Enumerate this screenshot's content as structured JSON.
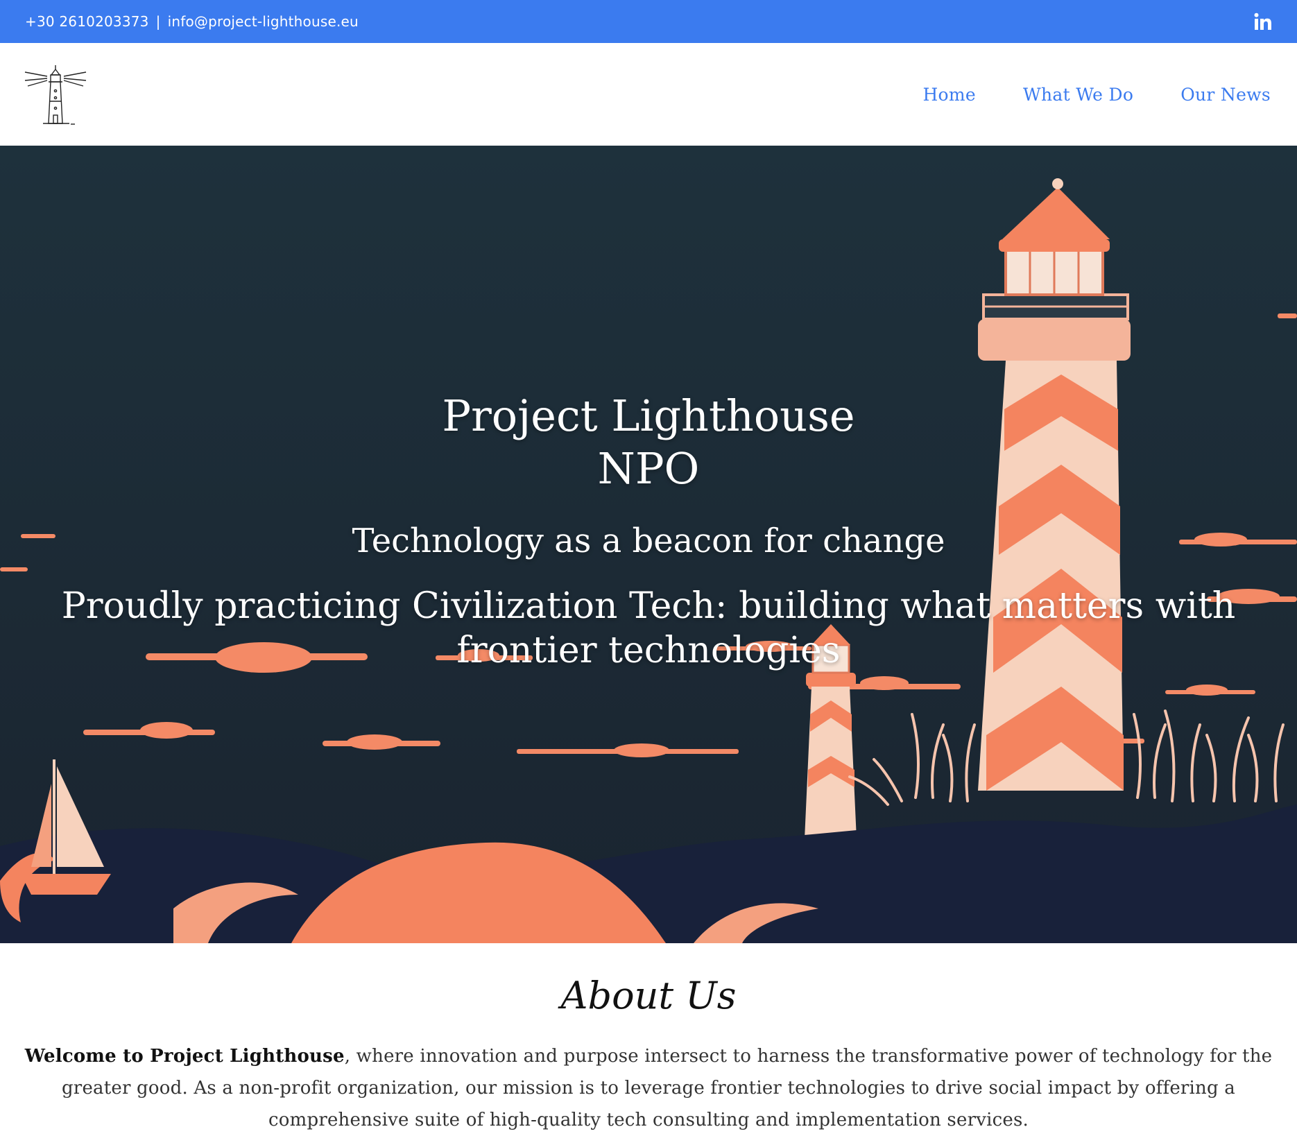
{
  "topbar": {
    "phone": "+30 2610203373",
    "separator": "|",
    "email": "info@project-lighthouse.eu",
    "social_icon": "linkedin-icon"
  },
  "header": {
    "logo_icon": "lighthouse-logo-icon",
    "nav": [
      {
        "label": "Home"
      },
      {
        "label": "What We Do"
      },
      {
        "label": "Our News"
      }
    ]
  },
  "hero": {
    "title_line1": "Project Lighthouse",
    "title_line2": "NPO",
    "tagline": "Technology as a beacon for change",
    "subtitle": "Proudly practicing Civilization Tech: building what matters with frontier technologies"
  },
  "about": {
    "heading": "About Us",
    "intro_bold": "Welcome to Project Lighthouse",
    "intro_rest": ", where innovation and purpose intersect to harness the transformative power of technology for the greater good. As a non-profit organization, our mission is to leverage frontier technologies to drive social impact by offering a comprehensive suite of high-quality tech consulting and implementation services."
  },
  "colors": {
    "brand_blue": "#3b7bef",
    "hero_dark": "#1c2a35",
    "accent_coral": "#f4845f",
    "accent_peach": "#f7d2bd"
  }
}
